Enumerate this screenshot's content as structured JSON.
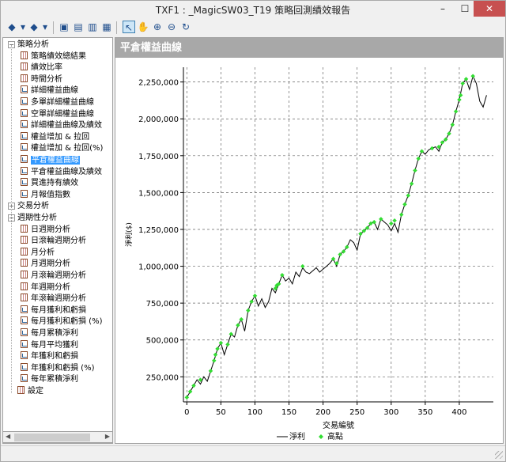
{
  "window": {
    "title": "TXF1 : _MagicSW03_T19 策略回測績效報告"
  },
  "toolbar": {
    "buttons": [
      {
        "name": "back-icon",
        "glyph": "◆"
      },
      {
        "name": "dropdown-icon",
        "glyph": "▾"
      },
      {
        "name": "forward-icon",
        "glyph": "◆"
      },
      {
        "name": "dropdown-icon",
        "glyph": "▾"
      },
      {
        "name": "save-icon",
        "glyph": "▣"
      },
      {
        "name": "export-icon",
        "glyph": "▤"
      },
      {
        "name": "print-icon",
        "glyph": "▥"
      },
      {
        "name": "calculator-icon",
        "glyph": "▦"
      },
      {
        "name": "pointer-icon",
        "glyph": "↖"
      },
      {
        "name": "hand-icon",
        "glyph": "✋"
      },
      {
        "name": "zoom-in-icon",
        "glyph": "⊕"
      },
      {
        "name": "zoom-out-icon",
        "glyph": "⊖"
      },
      {
        "name": "refresh-icon",
        "glyph": "↻"
      }
    ]
  },
  "tree": {
    "items": [
      {
        "label": "策略分析",
        "level": 0,
        "kind": "group",
        "expanded": true
      },
      {
        "label": "策略績效總結果",
        "level": 1,
        "kind": "grid"
      },
      {
        "label": "績效比率",
        "level": 1,
        "kind": "grid"
      },
      {
        "label": "時間分析",
        "level": 1,
        "kind": "grid"
      },
      {
        "label": "詳細權益曲線",
        "level": 1,
        "kind": "chart"
      },
      {
        "label": "多單詳細權益曲線",
        "level": 1,
        "kind": "chart"
      },
      {
        "label": "空單詳細權益曲線",
        "level": 1,
        "kind": "chart"
      },
      {
        "label": "詳細權益曲線及績效",
        "level": 1,
        "kind": "chart"
      },
      {
        "label": "權益增加 & 拉回",
        "level": 1,
        "kind": "chart"
      },
      {
        "label": "權益增加 & 拉回(%)",
        "level": 1,
        "kind": "chart"
      },
      {
        "label": "平倉權益曲線",
        "level": 1,
        "kind": "chart",
        "selected": true
      },
      {
        "label": "平倉權益曲線及績效",
        "level": 1,
        "kind": "chart"
      },
      {
        "label": "買進持有績效",
        "level": 1,
        "kind": "chart"
      },
      {
        "label": "月報值指數",
        "level": 1,
        "kind": "chart"
      },
      {
        "label": "交易分析",
        "level": 0,
        "kind": "group",
        "expanded": false
      },
      {
        "label": "週期性分析",
        "level": 0,
        "kind": "group",
        "expanded": true
      },
      {
        "label": "日週期分析",
        "level": 1,
        "kind": "grid"
      },
      {
        "label": "日滾輪週期分析",
        "level": 1,
        "kind": "grid"
      },
      {
        "label": "月分析",
        "level": 1,
        "kind": "grid"
      },
      {
        "label": "月週期分析",
        "level": 1,
        "kind": "grid"
      },
      {
        "label": "月滾輪週期分析",
        "level": 1,
        "kind": "grid"
      },
      {
        "label": "年週期分析",
        "level": 1,
        "kind": "grid"
      },
      {
        "label": "年滾輪週期分析",
        "level": 1,
        "kind": "grid"
      },
      {
        "label": "每月獲利和虧損",
        "level": 1,
        "kind": "chart"
      },
      {
        "label": "每月獲利和虧損 (%)",
        "level": 1,
        "kind": "chart"
      },
      {
        "label": "每月累積淨利",
        "level": 1,
        "kind": "chart"
      },
      {
        "label": "每月平均獲利",
        "level": 1,
        "kind": "chart"
      },
      {
        "label": "年獲利和虧損",
        "level": 1,
        "kind": "chart"
      },
      {
        "label": "年獲利和虧損 (%)",
        "level": 1,
        "kind": "chart"
      },
      {
        "label": "每年累積淨利",
        "level": 1,
        "kind": "chart"
      },
      {
        "label": "設定",
        "level": 0,
        "kind": "grid"
      }
    ]
  },
  "chart_header": "平倉權益曲線",
  "chart_data": {
    "type": "line",
    "xlabel": "交易編號",
    "ylabel": "淨利($)",
    "xlim": [
      -5,
      450
    ],
    "ylim": [
      80000,
      2350000
    ],
    "xticks": [
      0,
      50,
      100,
      150,
      200,
      250,
      300,
      350,
      400
    ],
    "yticks": [
      250000,
      500000,
      750000,
      1000000,
      1250000,
      1500000,
      1750000,
      2000000,
      2250000
    ],
    "xtick_labels": [
      "0",
      "50",
      "100",
      "150",
      "200",
      "250",
      "300",
      "350",
      "400"
    ],
    "ytick_labels": [
      "250,000",
      "500,000",
      "750,000",
      "1,000,000",
      "1,250,000",
      "1,500,000",
      "1,750,000",
      "2,000,000",
      "2,250,000"
    ],
    "grid": true,
    "legend_position": "bottom",
    "series": [
      {
        "name": "淨利",
        "color": "#000000",
        "style": "line",
        "x": [
          0,
          5,
          10,
          15,
          20,
          25,
          30,
          35,
          40,
          45,
          50,
          55,
          60,
          65,
          70,
          75,
          80,
          85,
          90,
          95,
          100,
          105,
          110,
          115,
          120,
          125,
          130,
          135,
          140,
          145,
          150,
          155,
          160,
          165,
          170,
          175,
          180,
          185,
          190,
          195,
          200,
          205,
          210,
          215,
          220,
          225,
          230,
          235,
          240,
          245,
          250,
          255,
          260,
          265,
          270,
          275,
          280,
          285,
          290,
          295,
          300,
          305,
          310,
          315,
          320,
          325,
          330,
          335,
          340,
          345,
          350,
          355,
          360,
          365,
          370,
          375,
          380,
          385,
          390,
          395,
          400,
          405,
          410,
          415,
          420,
          425,
          430,
          435,
          440
        ],
        "y": [
          110000,
          150000,
          190000,
          230000,
          200000,
          250000,
          220000,
          290000,
          360000,
          440000,
          480000,
          400000,
          470000,
          540000,
          520000,
          600000,
          640000,
          560000,
          700000,
          760000,
          800000,
          730000,
          780000,
          720000,
          760000,
          850000,
          820000,
          880000,
          940000,
          900000,
          920000,
          880000,
          960000,
          930000,
          990000,
          960000,
          950000,
          970000,
          990000,
          960000,
          980000,
          1000000,
          1020000,
          1050000,
          1000000,
          1080000,
          1100000,
          1130000,
          1180000,
          1160000,
          1110000,
          1220000,
          1240000,
          1260000,
          1290000,
          1300000,
          1250000,
          1320000,
          1300000,
          1280000,
          1240000,
          1290000,
          1230000,
          1350000,
          1420000,
          1480000,
          1560000,
          1650000,
          1730000,
          1780000,
          1760000,
          1790000,
          1800000,
          1810000,
          1780000,
          1840000,
          1860000,
          1900000,
          1960000,
          2050000,
          2130000,
          2240000,
          2270000,
          2200000,
          2290000,
          2240000,
          2120000,
          2080000,
          2160000
        ]
      },
      {
        "name": "高點",
        "color": "#33dd33",
        "style": "markers",
        "x": [
          0,
          5,
          10,
          20,
          35,
          40,
          42,
          45,
          50,
          60,
          65,
          75,
          80,
          90,
          95,
          100,
          130,
          132,
          135,
          140,
          170,
          215,
          220,
          225,
          230,
          235,
          255,
          260,
          265,
          270,
          275,
          285,
          300,
          305,
          315,
          320,
          325,
          330,
          335,
          340,
          345,
          360,
          370,
          375,
          380,
          385,
          390,
          395,
          400,
          402,
          405,
          410,
          420
        ],
        "y": [
          110000,
          150000,
          190000,
          230000,
          290000,
          360000,
          400000,
          440000,
          480000,
          470000,
          540000,
          600000,
          640000,
          700000,
          760000,
          800000,
          850000,
          870000,
          880000,
          940000,
          1000000,
          1050000,
          1020000,
          1080000,
          1100000,
          1130000,
          1220000,
          1240000,
          1260000,
          1290000,
          1300000,
          1320000,
          1290000,
          1310000,
          1350000,
          1420000,
          1480000,
          1560000,
          1650000,
          1730000,
          1780000,
          1800000,
          1810000,
          1840000,
          1860000,
          1900000,
          1960000,
          2050000,
          2130000,
          2160000,
          2240000,
          2270000,
          2290000
        ]
      }
    ]
  }
}
